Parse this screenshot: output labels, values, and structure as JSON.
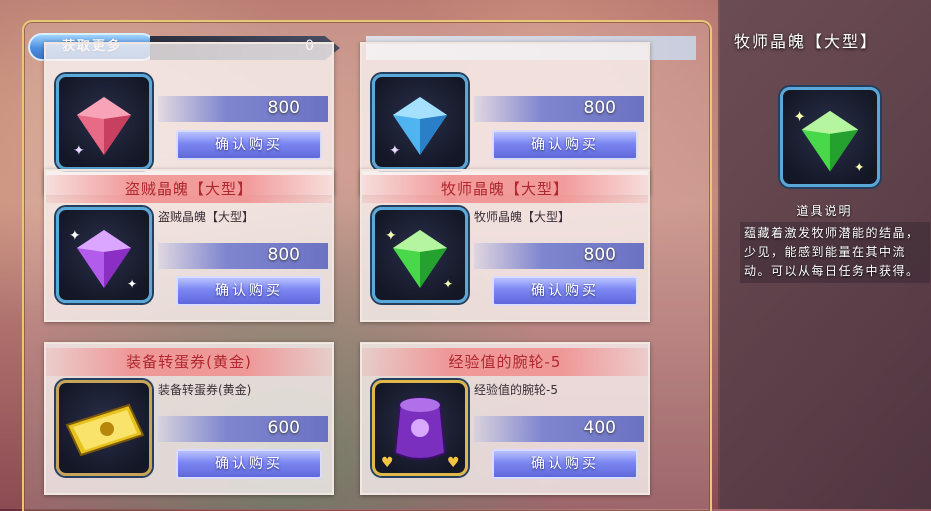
{
  "colors": {
    "panel_border": "#e8c77a",
    "title_text": "#b0282f",
    "buy_button": "#7b86f2",
    "icon_frame": "#5aa8d8"
  },
  "topbar": {
    "get_more_label": "获取更多",
    "currency_count": "0"
  },
  "cards": [
    {
      "title": "",
      "desc": "",
      "price": "800",
      "buy_label": "确认购买",
      "icon": "red-crystal-icon"
    },
    {
      "title": "",
      "desc": "",
      "price": "800",
      "buy_label": "确认购买",
      "icon": "blue-crystal-icon"
    },
    {
      "title": "盗贼晶魄【大型】",
      "desc": "盗贼晶魄【大型】",
      "price": "800",
      "buy_label": "确认购买",
      "icon": "purple-crystal-icon"
    },
    {
      "title": "牧师晶魄【大型】",
      "desc": "牧师晶魄【大型】",
      "price": "800",
      "buy_label": "确认购买",
      "icon": "green-crystal-icon"
    },
    {
      "title": "装备转蛋券(黄金)",
      "desc": "装备转蛋券(黄金)",
      "price": "600",
      "buy_label": "确认购买",
      "icon": "gold-ticket-icon"
    },
    {
      "title": "经验值的腕轮-5",
      "desc": "经验值的腕轮-5",
      "price": "400",
      "buy_label": "确认购买",
      "icon": "purple-bracelet-icon"
    }
  ],
  "detail": {
    "title": "牧师晶魄【大型】",
    "section_label": "道具说明",
    "description": "蕴藏着激发牧师潜能的结晶，少见，能感到能量在其中流动。可以从每日任务中获得。",
    "icon": "green-crystal-icon"
  }
}
